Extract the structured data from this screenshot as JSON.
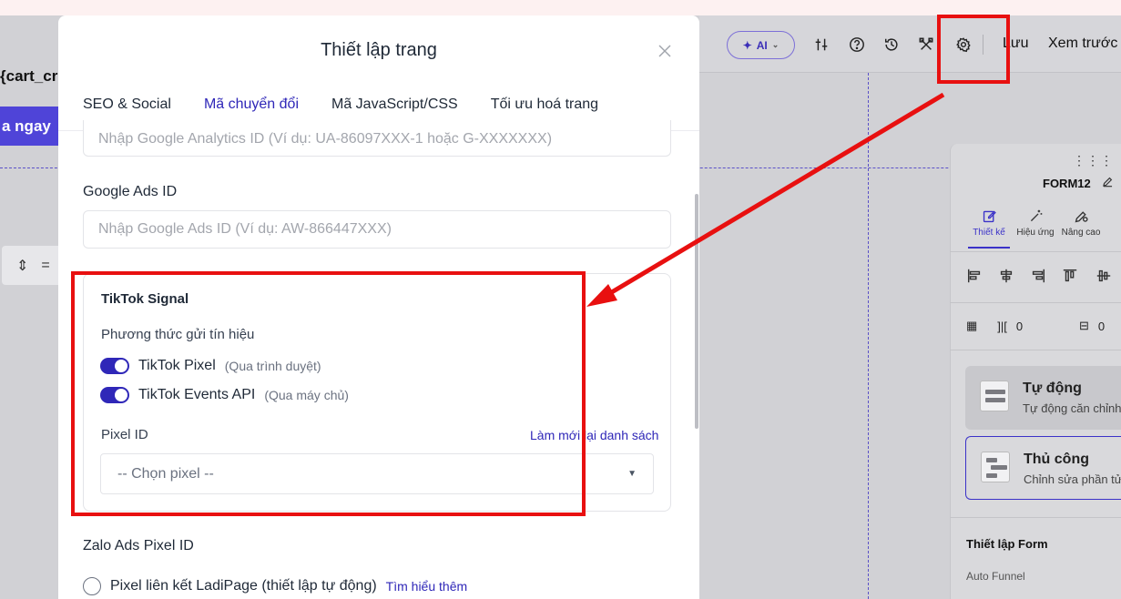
{
  "editor": {
    "ai_label": "AI",
    "save_label": "Lưu",
    "preview_label": "Xem trước",
    "left_fragment": "{cart_cr",
    "left_button_label": "a ngay"
  },
  "modal": {
    "title": "Thiết lập trang",
    "tabs": [
      {
        "label": "SEO & Social"
      },
      {
        "label": "Mã chuyển đổi"
      },
      {
        "label": "Mã JavaScript/CSS"
      },
      {
        "label": "Tối ưu hoá trang"
      }
    ],
    "active_tab": "Mã chuyển đổi",
    "ga_placeholder": "Nhập Google Analytics ID (Ví dụ: UA-86097XXX-1 hoặc G-XXXXXXX)",
    "google_ads": {
      "label": "Google Ads ID",
      "placeholder": "Nhập Google Ads ID (Ví dụ: AW-866447XXX)"
    },
    "tiktok": {
      "title": "TikTok Signal",
      "method_label": "Phương thức gửi tín hiệu",
      "pixel": {
        "label": "TikTok Pixel",
        "hint": "(Qua trình duyệt)"
      },
      "events_api": {
        "label": "TikTok Events API",
        "hint": "(Qua máy chủ)"
      },
      "pixel_id_label": "Pixel ID",
      "refresh_link": "Làm mới lại danh sách",
      "select_placeholder": "-- Chọn pixel --"
    },
    "zalo": {
      "label": "Zalo Ads Pixel ID",
      "radio_label": "Pixel liên kết LadiPage (thiết lập tự động)",
      "learn_more": "Tìm hiểu thêm"
    }
  },
  "right_panel": {
    "form_name": "FORM12",
    "tabs": [
      {
        "label": "Thiết kế"
      },
      {
        "label": "Hiệu ứng"
      },
      {
        "label": "Nâng cao"
      }
    ],
    "gap_value": "0",
    "spacing_value": "0",
    "auto_card": {
      "title": "Tự động",
      "desc": "Tự động căn chỉnh"
    },
    "manual_card": {
      "title": "Thủ công",
      "desc": "Chỉnh sửa phần tử"
    },
    "form_settings_label": "Thiết lập Form",
    "auto_funnel_label": "Auto Funnel"
  },
  "colors": {
    "accent": "#2f27b8",
    "annotation": "#e81010"
  }
}
